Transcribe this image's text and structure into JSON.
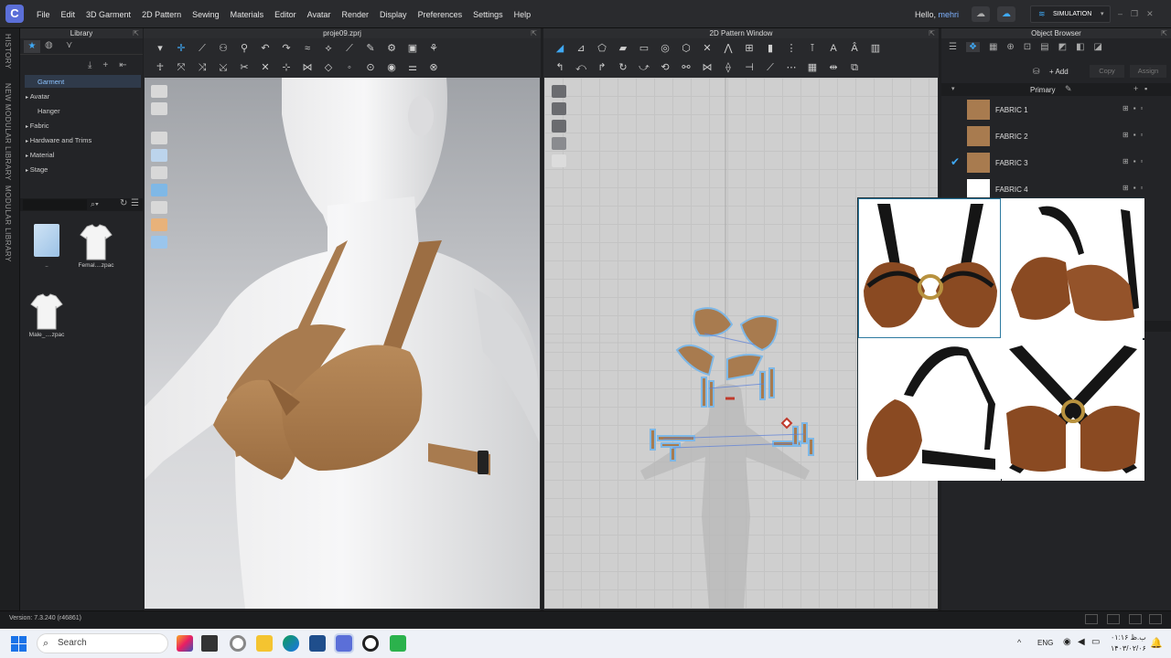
{
  "menubar": {
    "items": [
      "File",
      "Edit",
      "3D Garment",
      "2D Pattern",
      "Sewing",
      "Materials",
      "Editor",
      "Avatar",
      "Render",
      "Display",
      "Preferences",
      "Settings",
      "Help"
    ],
    "hello_prefix": "Hello,",
    "username": "mehri",
    "mode": "SIMULATION"
  },
  "side_tabs": [
    "HISTORY",
    "NEW MODULAR LIBRARY",
    "MODULAR LIBRARY"
  ],
  "library": {
    "title": "Library",
    "tree": [
      "Garment",
      "Avatar",
      "Hanger",
      "Fabric",
      "Hardware and Trims",
      "Material",
      "Stage"
    ],
    "files": [
      "..",
      "Femal....zpac",
      "Male_....zpac"
    ]
  },
  "view3d": {
    "title": "proje09.zprj"
  },
  "view2d": {
    "title": "2D Pattern Window"
  },
  "object_browser": {
    "title": "Object Browser",
    "add_label": "+ Add",
    "copy_label": "Copy",
    "assign_label": "Assign",
    "group_label": "Primary",
    "fabrics": [
      {
        "name": "FABRIC 1",
        "color": "#a87b4f",
        "checked": false
      },
      {
        "name": "FABRIC 2",
        "color": "#a87b4f",
        "checked": false
      },
      {
        "name": "FABRIC 3",
        "color": "#a87b4f",
        "checked": true
      },
      {
        "name": "FABRIC 4",
        "color": "#ffffff",
        "checked": false
      }
    ]
  },
  "status": {
    "version": "Version: 7.3.240 (r46861)"
  },
  "taskbar": {
    "search_placeholder": "Search",
    "lang": "ENG",
    "time": "۰۱:۱۶ ب.ظ",
    "date": "۱۴۰۳/۰۲/۰۶"
  },
  "colors": {
    "accent": "#3fa9f5",
    "garment": "#a87b4f",
    "leather": "#8a4a22"
  }
}
